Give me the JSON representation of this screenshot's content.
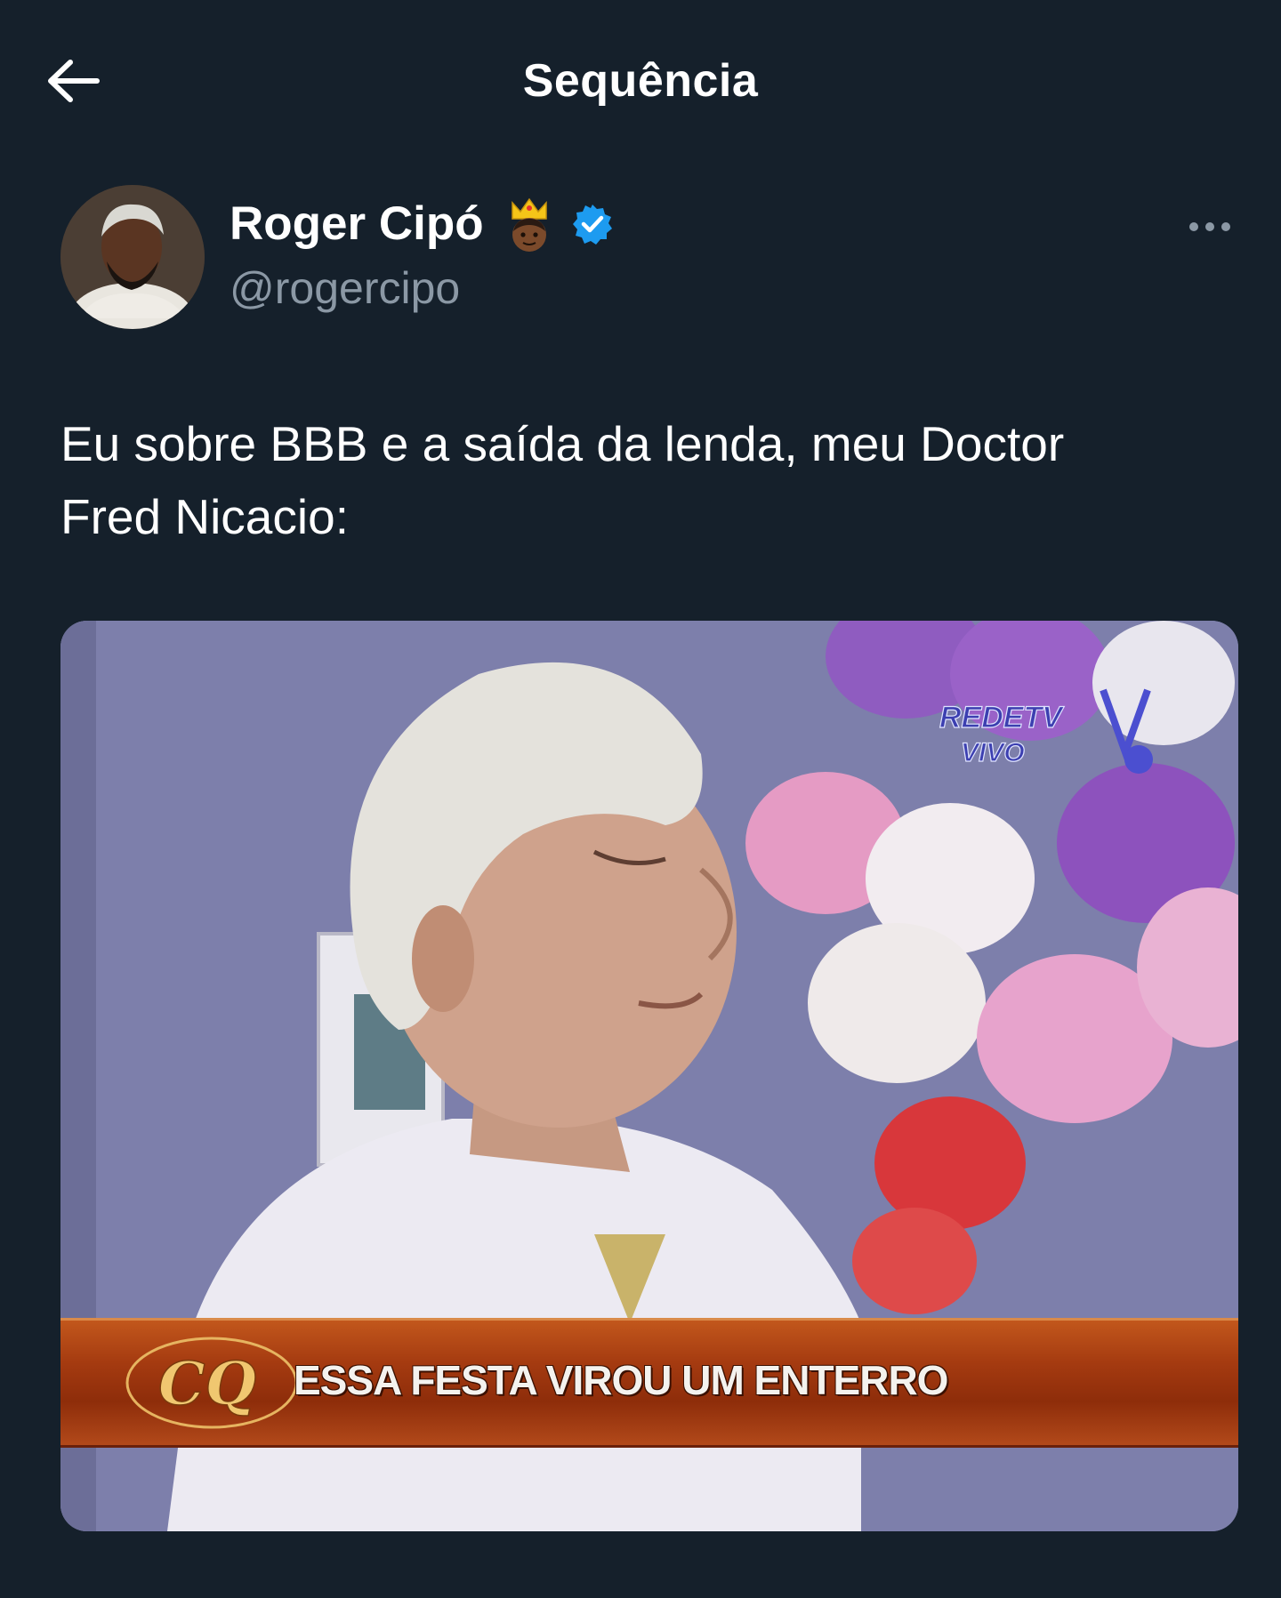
{
  "header": {
    "title": "Sequência",
    "back_icon": "arrow-left-icon"
  },
  "tweet": {
    "author": {
      "display_name": "Roger Cipó",
      "handle": "@rogercipo",
      "name_emoji": "crown-person-emoji",
      "verified_icon": "verified-badge-icon",
      "verified_color": "#1d9bf0"
    },
    "more_icon": "more-options-icon",
    "text": "Eu sobre BBB e a saída da lenda, meu Doctor\nFred Nicacio:",
    "media": {
      "caption": "ESSA FESTA VIROU UM ENTERRO",
      "logo_text": "CQ",
      "watermark_top": "REDETV",
      "watermark_bottom": "VIVO"
    }
  },
  "colors": {
    "background": "#15202b",
    "text_primary": "#ffffff",
    "text_secondary": "#8b98a5"
  }
}
